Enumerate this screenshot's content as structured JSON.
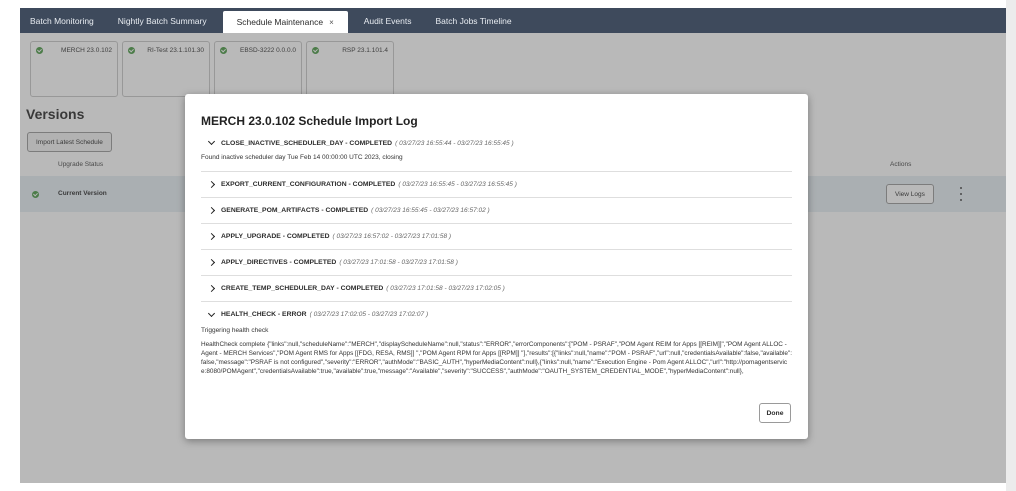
{
  "tabs": [
    {
      "label": "Batch Monitoring"
    },
    {
      "label": "Nightly Batch Summary"
    },
    {
      "label": "Schedule Maintenance",
      "close_glyph": "×"
    },
    {
      "label": "Audit Events"
    },
    {
      "label": "Batch Jobs Timeline"
    }
  ],
  "tiles": [
    {
      "label": "MERCH 23.0.102",
      "icon": "check-circle-icon"
    },
    {
      "label": "RI-Test 23.1.101.30",
      "icon": "check-circle-icon"
    },
    {
      "label": "EBSD-3222 0.0.0.0",
      "icon": "check-circle-icon"
    },
    {
      "label": "RSP 23.1.101.4",
      "icon": "check-circle-icon"
    }
  ],
  "versions": {
    "title": "Versions",
    "import_label": "Import Latest Schedule",
    "col_upgrade": "Upgrade Status",
    "col_actions": "Actions",
    "current_label": "Current Version",
    "view_logs_label": "View Logs"
  },
  "modal": {
    "title": "MERCH 23.0.102 Schedule Import Log",
    "steps": [
      {
        "name": "CLOSE_INACTIVE_SCHEDULER_DAY - COMPLETED",
        "time": "( 03/27/23 16:55:44 - 03/27/23 16:55:45 )",
        "expanded": true,
        "detail": "Found inactive scheduler day Tue Feb 14 00:00:00 UTC 2023, closing"
      },
      {
        "name": "EXPORT_CURRENT_CONFIGURATION - COMPLETED",
        "time": "( 03/27/23 16:55:45 - 03/27/23 16:55:45 )",
        "expanded": false
      },
      {
        "name": "GENERATE_POM_ARTIFACTS - COMPLETED",
        "time": "( 03/27/23 16:55:45 - 03/27/23 16:57:02 )",
        "expanded": false
      },
      {
        "name": "APPLY_UPGRADE - COMPLETED",
        "time": "( 03/27/23 16:57:02 - 03/27/23 17:01:58 )",
        "expanded": false
      },
      {
        "name": "APPLY_DIRECTIVES - COMPLETED",
        "time": "( 03/27/23 17:01:58 - 03/27/23 17:01:58 )",
        "expanded": false
      },
      {
        "name": "CREATE_TEMP_SCHEDULER_DAY - COMPLETED",
        "time": "( 03/27/23 17:01:58 - 03/27/23 17:02:05 )",
        "expanded": false
      },
      {
        "name": "HEALTH_CHECK - ERROR",
        "time": "( 03/27/23 17:02:05 - 03/27/23 17:02:07 )",
        "expanded": true,
        "detail": "Triggering health check",
        "detail2": "HealthCheck complete {\"links\":null,\"scheduleName\":\"MERCH\",\"displayScheduleName\":null,\"status\":\"ERROR\",\"errorComponents\":[\"POM - PSRAF\",\"POM Agent REIM for Apps [[REIM]]\",\"POM Agent ALLOC - Agent - MERCH Services\",\"POM Agent RMS for Apps [[FDG, RESA, RMS]] \",\"POM Agent RPM for Apps [[RPM]] \"],\"results\":[{\"links\":null,\"name\":\"POM - PSRAF\",\"url\":null,\"credentialsAvailable\":false,\"available\":false,\"message\":\"PSRAF is not configured\",\"severity\":\"ERROR\",\"authMode\":\"BASIC_AUTH\",\"hyperMediaContent\":null},{\"links\":null,\"name\":\"Execution Engine - Pom Agent ALLOC\",\"url\":\"http://pomagentservice:8080/POMAgent\",\"credentialsAvailable\":true,\"available\":true,\"message\":\"Available\",\"severity\":\"SUCCESS\",\"authMode\":\"OAUTH_SYSTEM_CREDENTIAL_MODE\",\"hyperMediaContent\":null},"
      }
    ],
    "done_label": "Done"
  }
}
